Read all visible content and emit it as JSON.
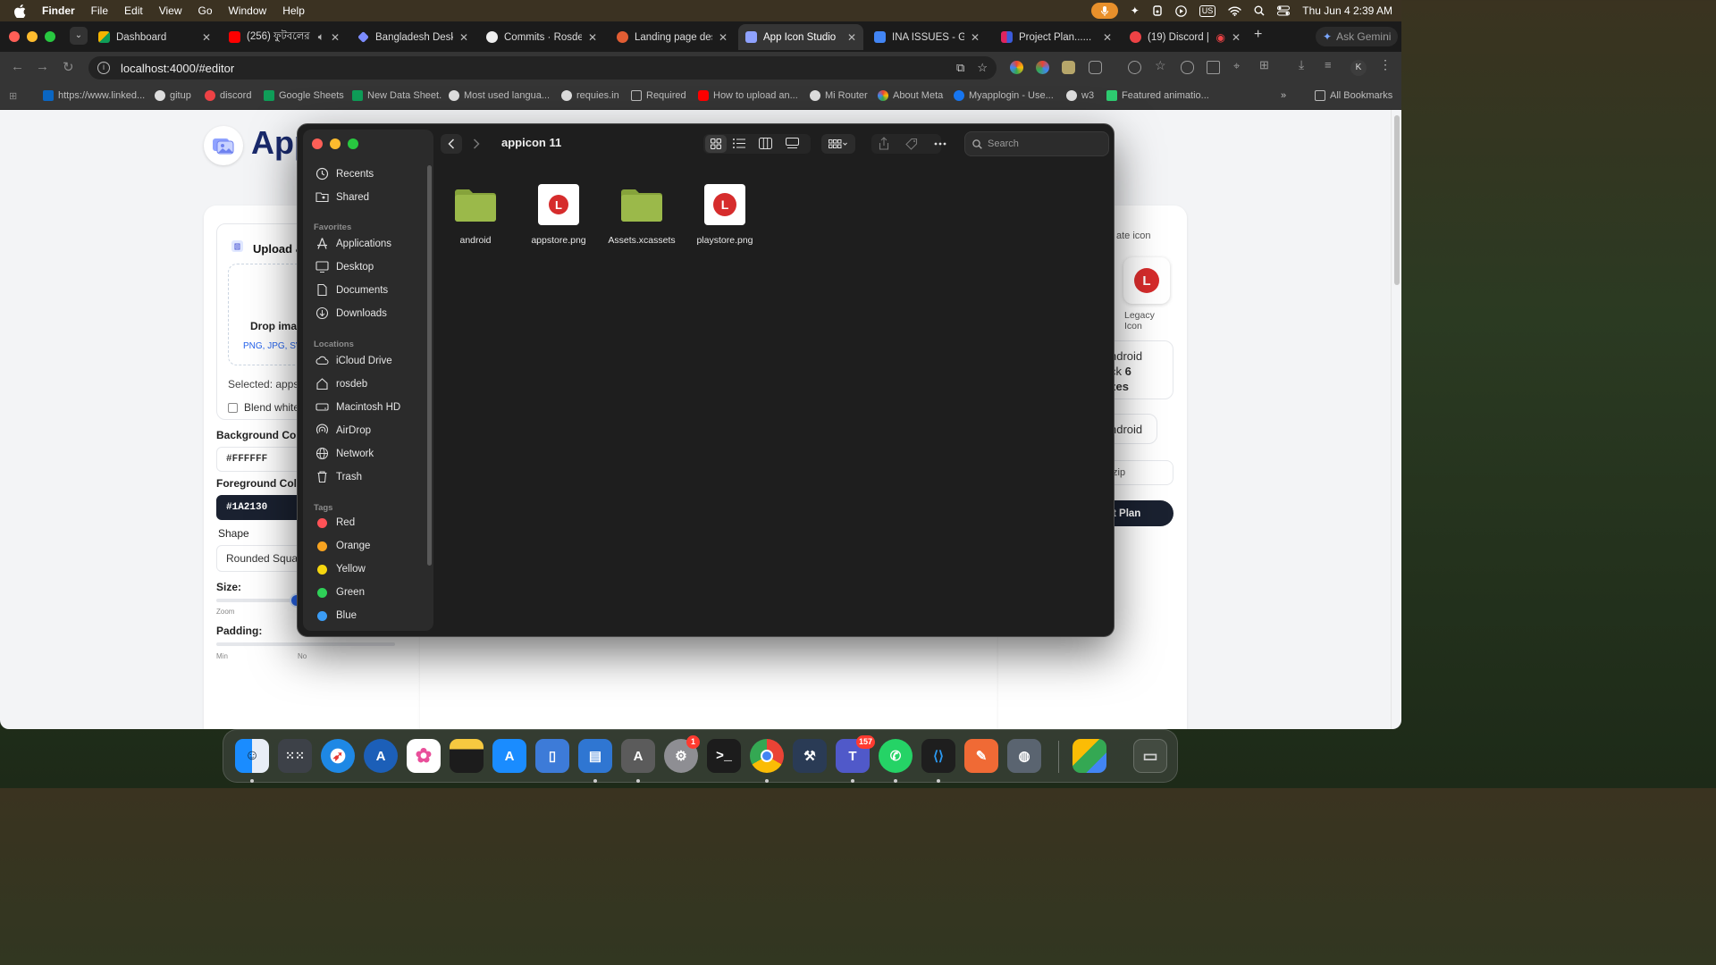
{
  "menubar": {
    "apple": "",
    "app_name": "Finder",
    "menus": [
      "File",
      "Edit",
      "View",
      "Go",
      "Window",
      "Help"
    ],
    "status": {
      "input": "US",
      "datetime": "Thu Jun 4  2:39 AM"
    }
  },
  "browser": {
    "tabs": [
      {
        "title": "Dashboard",
        "favicon_color": "#ffffff",
        "active": false
      },
      {
        "title": "(256) ফুটবলের",
        "favicon_color": "#ff0000",
        "active": false
      },
      {
        "title": "Bangladesh Deskt",
        "favicon_color": "#7c8cff",
        "active": false
      },
      {
        "title": "Commits · Rosdeb",
        "favicon_color": "#eeeeee",
        "active": false
      },
      {
        "title": "Landing page desi",
        "favicon_color": "#e25d33",
        "active": false
      },
      {
        "title": "App Icon Studio",
        "favicon_color": "#8fa2ff",
        "active": true
      },
      {
        "title": "INA ISSUES - Goo",
        "favicon_color": "#4285f4",
        "active": false
      },
      {
        "title": "Project Plan......",
        "favicon_color": "#e0245e",
        "active": false
      },
      {
        "title": "(19) Discord | (",
        "favicon_color": "#ed4245",
        "active": false
      }
    ],
    "ask_gemini": "Ask Gemini",
    "url": "localhost:4000/#editor",
    "profile_initial": "K",
    "bookmarks": [
      {
        "label": "https://www.linked...",
        "color": "#0a66c2"
      },
      {
        "label": "gitup",
        "color": "#dddddd"
      },
      {
        "label": "discord",
        "color": "#ed4245"
      },
      {
        "label": "Google Sheets",
        "color": "#0f9d58"
      },
      {
        "label": "New Data Sheet.",
        "color": "#0f9d58"
      },
      {
        "label": "Most used langua...",
        "color": "#dddddd"
      },
      {
        "label": "requies.in",
        "color": "#dddddd"
      },
      {
        "label": "Required",
        "color": "#bbbbbb"
      },
      {
        "label": "How to upload an...",
        "color": "#ff0000"
      },
      {
        "label": "Mi Router",
        "color": "#dddddd"
      },
      {
        "label": "About Meta",
        "color": "#dddddd"
      },
      {
        "label": "Myapplogin - Use...",
        "color": "#1877f2"
      },
      {
        "label": "w3",
        "color": "#dddddd"
      },
      {
        "label": "Featured animatio...",
        "color": "#2ecc71"
      }
    ],
    "all_bookmarks": "All Bookmarks"
  },
  "webpage": {
    "brand": "App",
    "upload_title": "Upload &",
    "drop_text": "Drop imag",
    "drop_types": "PNG, JPG, SV",
    "selected": "Selected: apps",
    "blend": "Blend white",
    "bg_label": "Background Colo",
    "bg_value": "#FFFFFF",
    "fg_label": "Foreground Colo",
    "fg_value": "#1A2130",
    "shape_label": "Shape",
    "shape_value": "Rounded Squa",
    "size_label": "Size:",
    "size_value": 0.55,
    "zoom_label": "Zoom",
    "padding_label": "Padding:",
    "min_label": "Min",
    "normal_label": "No",
    "right": {
      "generate": "ate icon",
      "legacy1": "Legacy",
      "legacy2": "Icon",
      "android1": "ndroid",
      "pack": "ck",
      "pack_count": "6",
      "sizes": "zes",
      "android_btn": "ndroid",
      "zip": ".zip",
      "plan": "t Plan"
    }
  },
  "finder": {
    "title": "appicon 11",
    "search_placeholder": "Search",
    "sidebar": {
      "top": [
        "Recents",
        "Shared"
      ],
      "favorites_header": "Favorites",
      "favorites": [
        "Applications",
        "Desktop",
        "Documents",
        "Downloads"
      ],
      "locations_header": "Locations",
      "locations": [
        "iCloud Drive",
        "rosdeb",
        "Macintosh HD",
        "AirDrop",
        "Network",
        "Trash"
      ],
      "tags_header": "Tags",
      "tags": [
        {
          "name": "Red",
          "color": "#ff5257"
        },
        {
          "name": "Orange",
          "color": "#f7a320"
        },
        {
          "name": "Yellow",
          "color": "#f5d60f"
        },
        {
          "name": "Green",
          "color": "#2fd158"
        },
        {
          "name": "Blue",
          "color": "#3b9cf5"
        }
      ]
    },
    "files": [
      {
        "name": "android",
        "kind": "folder"
      },
      {
        "name": "appstore.png",
        "kind": "png"
      },
      {
        "name": "Assets.xcassets",
        "kind": "folder"
      },
      {
        "name": "playstore.png",
        "kind": "png"
      }
    ],
    "folder_color": "#9bb94a",
    "icon_glyph": "L"
  },
  "dock": {
    "apps": [
      "Finder",
      "Launchpad",
      "Safari",
      "Instruments",
      "Photos",
      "Notes",
      "App Store",
      "Simulator",
      "Mail Preview",
      "Script Editor",
      "System Settings",
      "Terminal",
      "Chrome",
      "Xcode",
      "Teams",
      "WhatsApp",
      "VS Code",
      "Sketch",
      "Disk Utility",
      "Drive",
      "Trash"
    ],
    "badges": {
      "settings": "1",
      "teams": "157"
    }
  }
}
